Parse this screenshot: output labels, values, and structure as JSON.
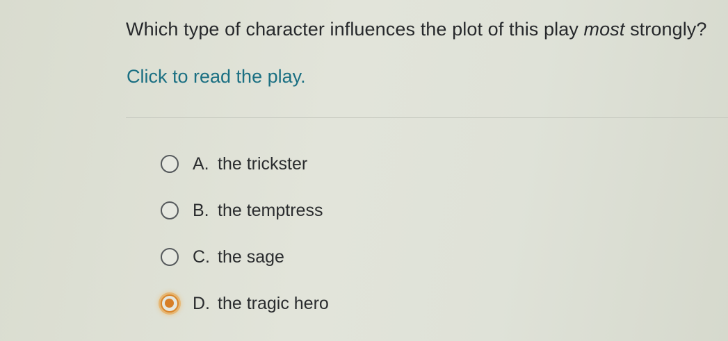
{
  "question": {
    "text_before": "Which type of character influences the plot of this play ",
    "emphasis": "most",
    "text_after": " strongly?"
  },
  "read_link": "Click to read the play.",
  "options": [
    {
      "letter": "A.",
      "text": "the trickster",
      "selected": false
    },
    {
      "letter": "B.",
      "text": "the temptress",
      "selected": false
    },
    {
      "letter": "C.",
      "text": "the sage",
      "selected": false
    },
    {
      "letter": "D.",
      "text": "the tragic hero",
      "selected": true
    }
  ],
  "colors": {
    "link": "#1a6f82",
    "selected_accent": "#d77e27"
  }
}
